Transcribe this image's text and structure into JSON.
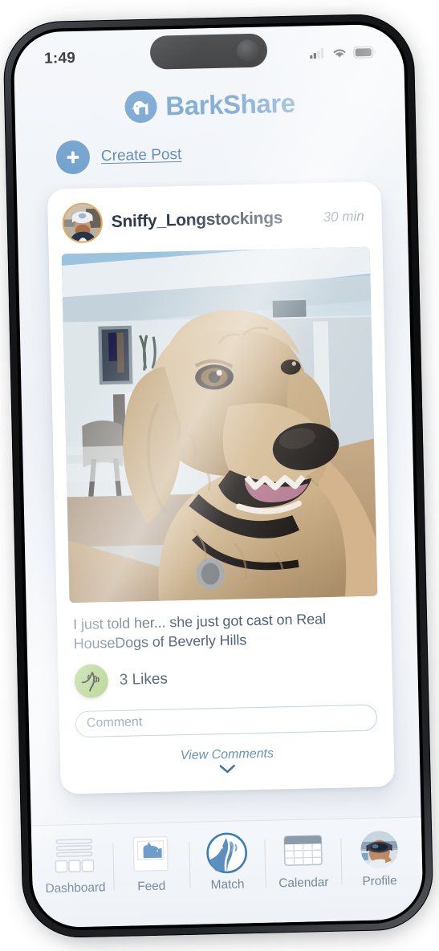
{
  "status_bar": {
    "time": "1:49",
    "signal_icon": "cellular-signal-icon",
    "wifi_icon": "wifi-icon",
    "battery_icon": "battery-icon"
  },
  "header": {
    "app_name": "BarkShare",
    "logo_icon": "dog-head-logo-icon",
    "brand_color": "#6fa0cd"
  },
  "create_post": {
    "label": "Create Post",
    "icon": "plus-icon"
  },
  "post": {
    "author": "Sniffy_Longstockings",
    "timestamp": "30 min",
    "avatar_icon": "user-avatar",
    "photo_alt": "golden doodle dog smiling indoors",
    "caption": "I just told her... she just got cast on Real HouseDogs of Beverly Hills",
    "likes": "3 Likes",
    "like_icon": "wagging-tail-like-icon",
    "like_color": "#a9cd7f",
    "comment_placeholder": "Comment",
    "comment_value": "",
    "view_comments": "View Comments",
    "view_comments_icon": "chevron-down-icon"
  },
  "tabbar": {
    "items": [
      {
        "label": "Dashboard",
        "icon": "dashboard-icon",
        "active": false
      },
      {
        "label": "Feed",
        "icon": "feed-photo-dog-icon",
        "active": false
      },
      {
        "label": "Match",
        "icon": "match-wagging-tail-icon",
        "active": true
      },
      {
        "label": "Calendar",
        "icon": "calendar-icon",
        "active": false
      },
      {
        "label": "Profile",
        "icon": "profile-avatar-icon",
        "active": false
      }
    ]
  }
}
